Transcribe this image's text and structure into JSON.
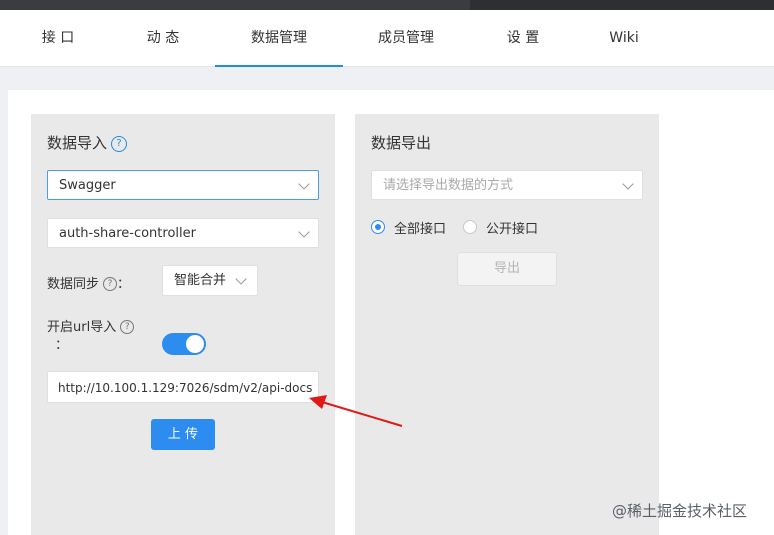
{
  "nav": {
    "tabs": [
      {
        "label": "接 口",
        "active": false
      },
      {
        "label": "动 态",
        "active": false
      },
      {
        "label": "数据管理",
        "active": true
      },
      {
        "label": "成员管理",
        "active": false
      },
      {
        "label": "设 置",
        "active": false
      },
      {
        "label": "Wiki",
        "active": false
      }
    ],
    "accent_color": "#1f8de0"
  },
  "import_panel": {
    "title": "数据导入",
    "help_icon": "question-circle-icon",
    "format_select": "Swagger",
    "controller_select": "auth-share-controller",
    "sync_label": "数据同步",
    "sync_colon": "：",
    "sync_select": "智能合并",
    "url_import_label": "开启url导入",
    "url_import_colon": "：",
    "url_import_enabled": true,
    "url_value": "http://10.100.1.129:7026/sdm/v2/api-docs",
    "upload_button": "上 传"
  },
  "export_panel": {
    "title": "数据导出",
    "method_placeholder": "请选择导出数据的方式",
    "radio_all": "全部接口",
    "radio_public": "公开接口",
    "radio_selected": "all",
    "export_button": "导出"
  },
  "annotation": {
    "arrow_color": "#e01818"
  },
  "watermark": "@稀土掘金技术社区"
}
